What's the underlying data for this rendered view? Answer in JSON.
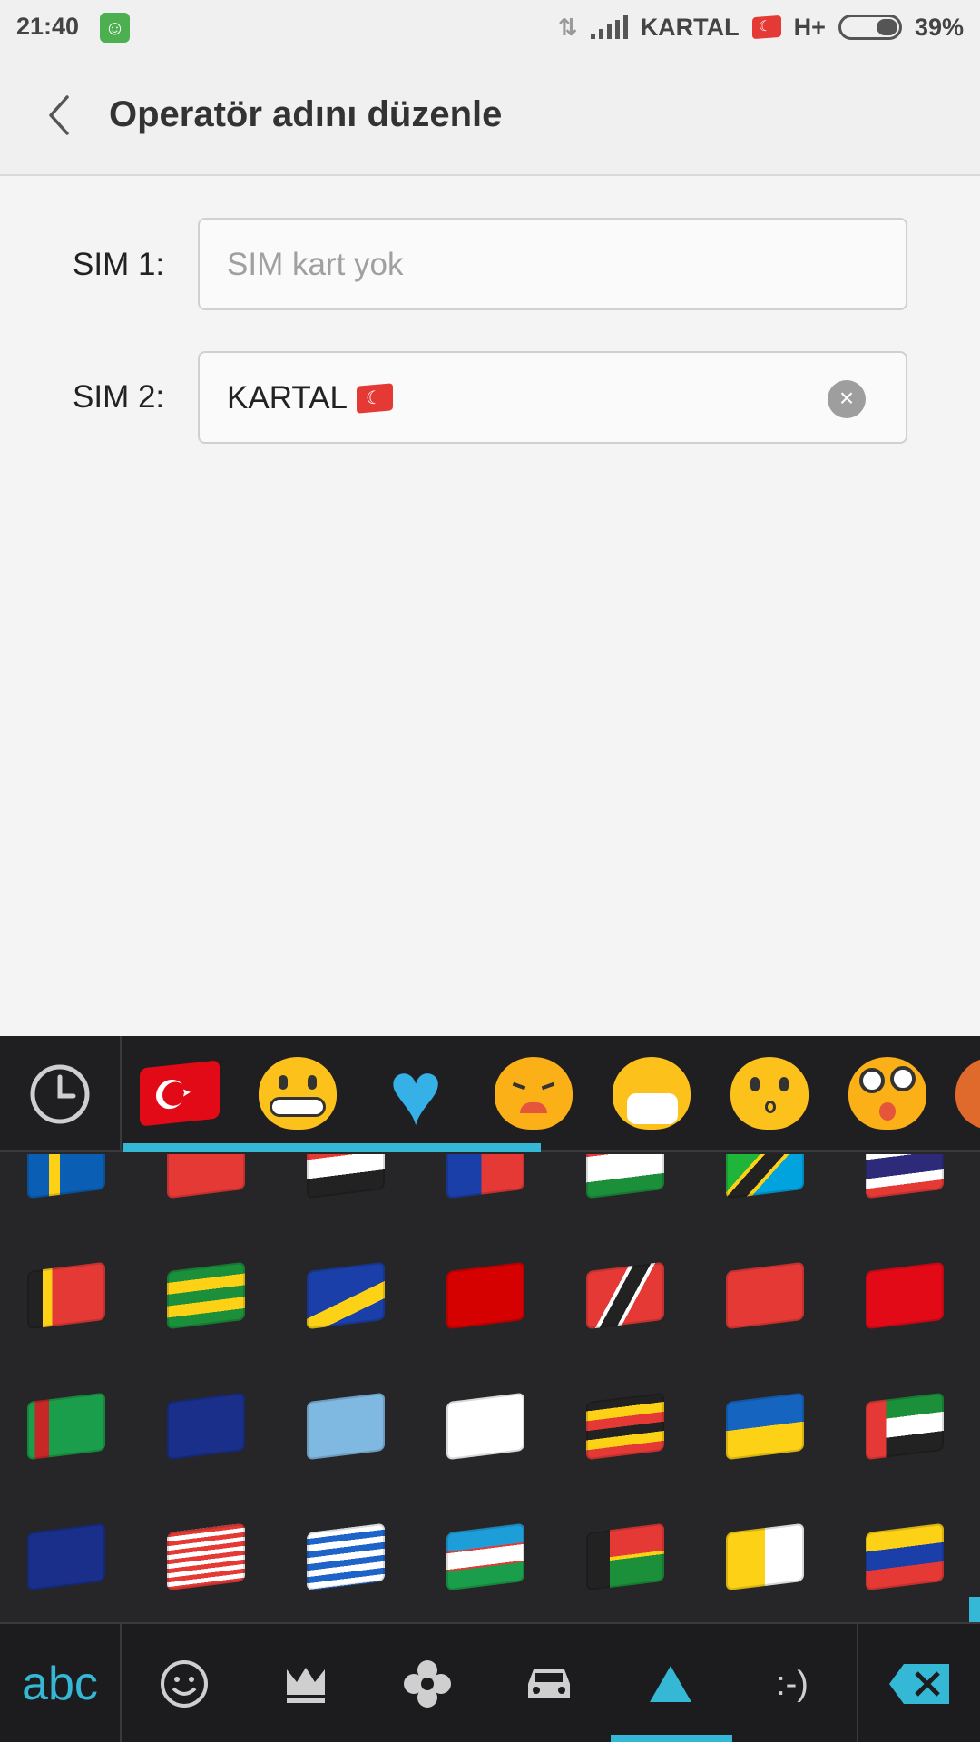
{
  "status_bar": {
    "time": "21:40",
    "carrier": "KARTAL",
    "network": "H+",
    "battery": "39%",
    "battery_level": 0.39,
    "icons": [
      "android-icon",
      "data-arrows-icon",
      "signal-icon",
      "turkey-flag-icon",
      "battery-icon"
    ]
  },
  "header": {
    "title": "Operatör adını düzenle",
    "back_icon": "chevron-left-icon"
  },
  "form": {
    "sim1": {
      "label": "SIM 1:",
      "placeholder": "SIM kart yok",
      "value": ""
    },
    "sim2": {
      "label": "SIM 2:",
      "value": "KARTAL",
      "value_flag": "turkey-flag",
      "clear_icon": "clear-icon"
    }
  },
  "keyboard": {
    "accent_color": "#35b8d6",
    "categories": [
      {
        "name": "recent-icon"
      },
      {
        "name": "turkey-flag-category"
      },
      {
        "name": "grimacing-face-category"
      },
      {
        "name": "blue-heart-category"
      },
      {
        "name": "disappointed-face-category"
      },
      {
        "name": "mask-face-category"
      },
      {
        "name": "kissing-face-category"
      },
      {
        "name": "dizzy-face-category"
      }
    ],
    "flag_rows": [
      [
        "sweden",
        "switzerland",
        "syria",
        "taiwan",
        "tajikistan",
        "tanzania",
        "thailand"
      ],
      [
        "timor-leste",
        "togo",
        "tokelau",
        "tonga",
        "trinidad-and-tobago",
        "tunisia",
        "turkey"
      ],
      [
        "turkmenistan",
        "turks-and-caicos",
        "tuvalu",
        "us-virgin-islands",
        "uganda",
        "ukraine",
        "uae"
      ],
      [
        "united-kingdom",
        "united-states",
        "uruguay",
        "uzbekistan",
        "vanuatu",
        "vatican-city",
        "venezuela"
      ]
    ],
    "bottom_bar": {
      "abc_label": "abc",
      "tabs": [
        "smiley-icon",
        "crown-icon",
        "flower-icon",
        "car-icon",
        "triangle-icon",
        "emoticon-text"
      ],
      "emoticon_label": ":-)",
      "active_tab": "triangle-icon",
      "delete_icon": "backspace-icon"
    }
  }
}
